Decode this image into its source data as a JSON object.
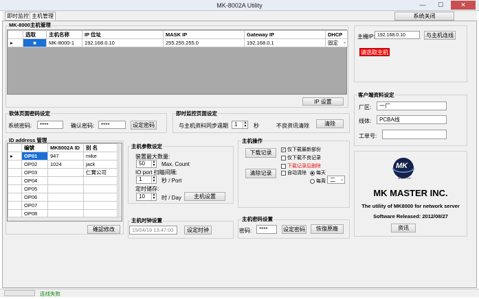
{
  "window": {
    "title": "MK-8002A Utility",
    "minimize": "—",
    "maximize": "☐",
    "close": "✕"
  },
  "tabs": [
    {
      "label": "即时监控"
    },
    {
      "label": "主机管理"
    }
  ],
  "close_system_button": "系统关闭",
  "host_mgmt": {
    "title": "MK-8000主机管理",
    "columns": [
      "选取",
      "主机名称",
      "IP 位址",
      "MASK IP",
      "Gateway IP",
      "DHCP"
    ],
    "rows": [
      {
        "select": "■",
        "name": "MK-8000-1",
        "ip": "192.168.0.10",
        "mask": "255.255.255.0",
        "gateway": "192.168.0.1",
        "dhcp": "固定"
      }
    ],
    "ip_setting_button": "IP 设置"
  },
  "host_connect": {
    "label": "主機IP:",
    "ip": "192.168.0.10",
    "connect_button": "与主机连线",
    "alert": "请选取主机"
  },
  "password_settings": {
    "title": "软体页面密码设定",
    "system_password_label": "系统密码:",
    "system_password": "****",
    "confirm_password_label": "确认密码:",
    "confirm_password": "****",
    "set_button": "设定密码"
  },
  "monitor_settings": {
    "title": "即时监控页面设定",
    "sync_label": "与主机资料同步週期",
    "sync_value": "1",
    "unit": "秒",
    "clear_label": "不良资讯清除",
    "clear_button": "清除"
  },
  "client_settings": {
    "title": "客户端资料设定",
    "factory_label": "厂区:",
    "factory": "一厂",
    "line_label": "线体:",
    "line": "PCBA线",
    "order_label": "工单号:",
    "order": ""
  },
  "id_address": {
    "title": "ID address 管理",
    "columns": [
      "编號",
      "MK8002A ID",
      "别 名"
    ],
    "rows": [
      {
        "no": "OP01",
        "id": "947",
        "alias": "mike"
      },
      {
        "no": "OP02",
        "id": "1024",
        "alias": "jack"
      },
      {
        "no": "OP03",
        "id": "",
        "alias": "仁寶公司"
      },
      {
        "no": "OP04",
        "id": "",
        "alias": ""
      },
      {
        "no": "OP05",
        "id": "",
        "alias": ""
      },
      {
        "no": "OP06",
        "id": "",
        "alias": ""
      },
      {
        "no": "OP07",
        "id": "",
        "alias": ""
      },
      {
        "no": "OP08",
        "id": "",
        "alias": ""
      }
    ],
    "confirm_button": "確認修改"
  },
  "host_params": {
    "title": "主机参数设定",
    "max_count_label": "装置最大数量:",
    "max_count": "50",
    "max_count_unit": "Max. Count",
    "io_port_label": "IO port 扫瞄间隔:",
    "io_port": "1",
    "io_port_unit": "秒 / Port",
    "save_label": "定时储存:",
    "save": "10",
    "save_unit": "时 / Day",
    "set_button": "主机设置"
  },
  "host_ops": {
    "title": "主机操作",
    "download_button": "下载记录",
    "clear_button": "清除记录",
    "opt1": "仅下载最新部份",
    "opt2": "仅下载不良记录",
    "opt3": "下载记录后删除",
    "auto_clear": "自动清除",
    "daily": "每天",
    "weekly": "每周",
    "weekday": "二"
  },
  "host_clock": {
    "title": "主机时钟设置",
    "time": "15/04/19 13:47:00",
    "set_button": "设定时钟"
  },
  "host_password": {
    "title": "主机密码设置",
    "label": "密码:",
    "value": "****",
    "set_button": "设定密码",
    "reset_button": "恢復原廠"
  },
  "about": {
    "logo_text": "MK",
    "logo_sub": "Master Inc.",
    "company": "MK MASTER INC.",
    "desc": "The utility of MK8000 for network server",
    "release": "Software Released: 2012/08/27",
    "info_button": "资讯"
  },
  "status": {
    "text": "连线失败"
  },
  "colors": {
    "selection": "#1a6fd8",
    "alert": "#ee1111",
    "status_text": "#118811",
    "grid_bg": "#a9a9a9"
  }
}
